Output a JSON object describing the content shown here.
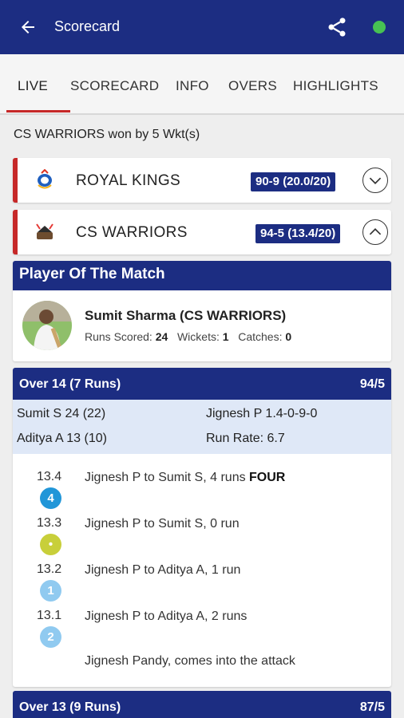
{
  "appbar": {
    "title": "Scorecard",
    "back_icon": "arrow-left-icon",
    "share_icon": "share-icon",
    "status_color": "#47c153"
  },
  "tabs": [
    {
      "label": "LIVE",
      "active": true
    },
    {
      "label": "SCORECARD"
    },
    {
      "label": "INFO"
    },
    {
      "label": "OVERS"
    },
    {
      "label": "HIGHLIGHTS"
    }
  ],
  "result": "CS WARRIORS won by 5 Wkt(s)",
  "teams": [
    {
      "name": "ROYAL KINGS",
      "score": "90-9 (20.0/20)",
      "expanded": false
    },
    {
      "name": "CS WARRIORS",
      "score": "94-5 (13.4/20)",
      "expanded": true
    }
  ],
  "potm": {
    "title": "Player Of The Match",
    "name": "Sumit Sharma (CS WARRIORS)",
    "runs_label": "Runs Scored:",
    "runs": "24",
    "wickets_label": "Wickets:",
    "wickets": "1",
    "catches_label": "Catches:",
    "catches": "0"
  },
  "over": {
    "title": "Over 14 (7 Runs)",
    "score": "94/5",
    "batter1": "Sumit S 24 (22)",
    "batter2": "Aditya A 13 (10)",
    "bowler": "Jignesh P 1.4-0-9-0",
    "run_rate": "Run Rate: 6.7",
    "balls": [
      {
        "no": "13.4",
        "badge": "4",
        "color": "#2196d8",
        "text": "Jignesh P to Sumit S, 4 runs ",
        "bold": "FOUR"
      },
      {
        "no": "13.3",
        "badge": "•",
        "color": "#c8cf3a",
        "text": "Jignesh P to Sumit S, 0 run",
        "bold": ""
      },
      {
        "no": "13.2",
        "badge": "1",
        "color": "#90caf0",
        "text": "Jignesh P to Aditya A, 1 run",
        "bold": ""
      },
      {
        "no": "13.1",
        "badge": "2",
        "color": "#90caf0",
        "text": "Jignesh P to Aditya A, 2 runs",
        "bold": ""
      }
    ],
    "note": "Jignesh Pandy, comes into the attack"
  },
  "next_over": {
    "title": "Over 13 (9 Runs)",
    "score": "87/5"
  }
}
